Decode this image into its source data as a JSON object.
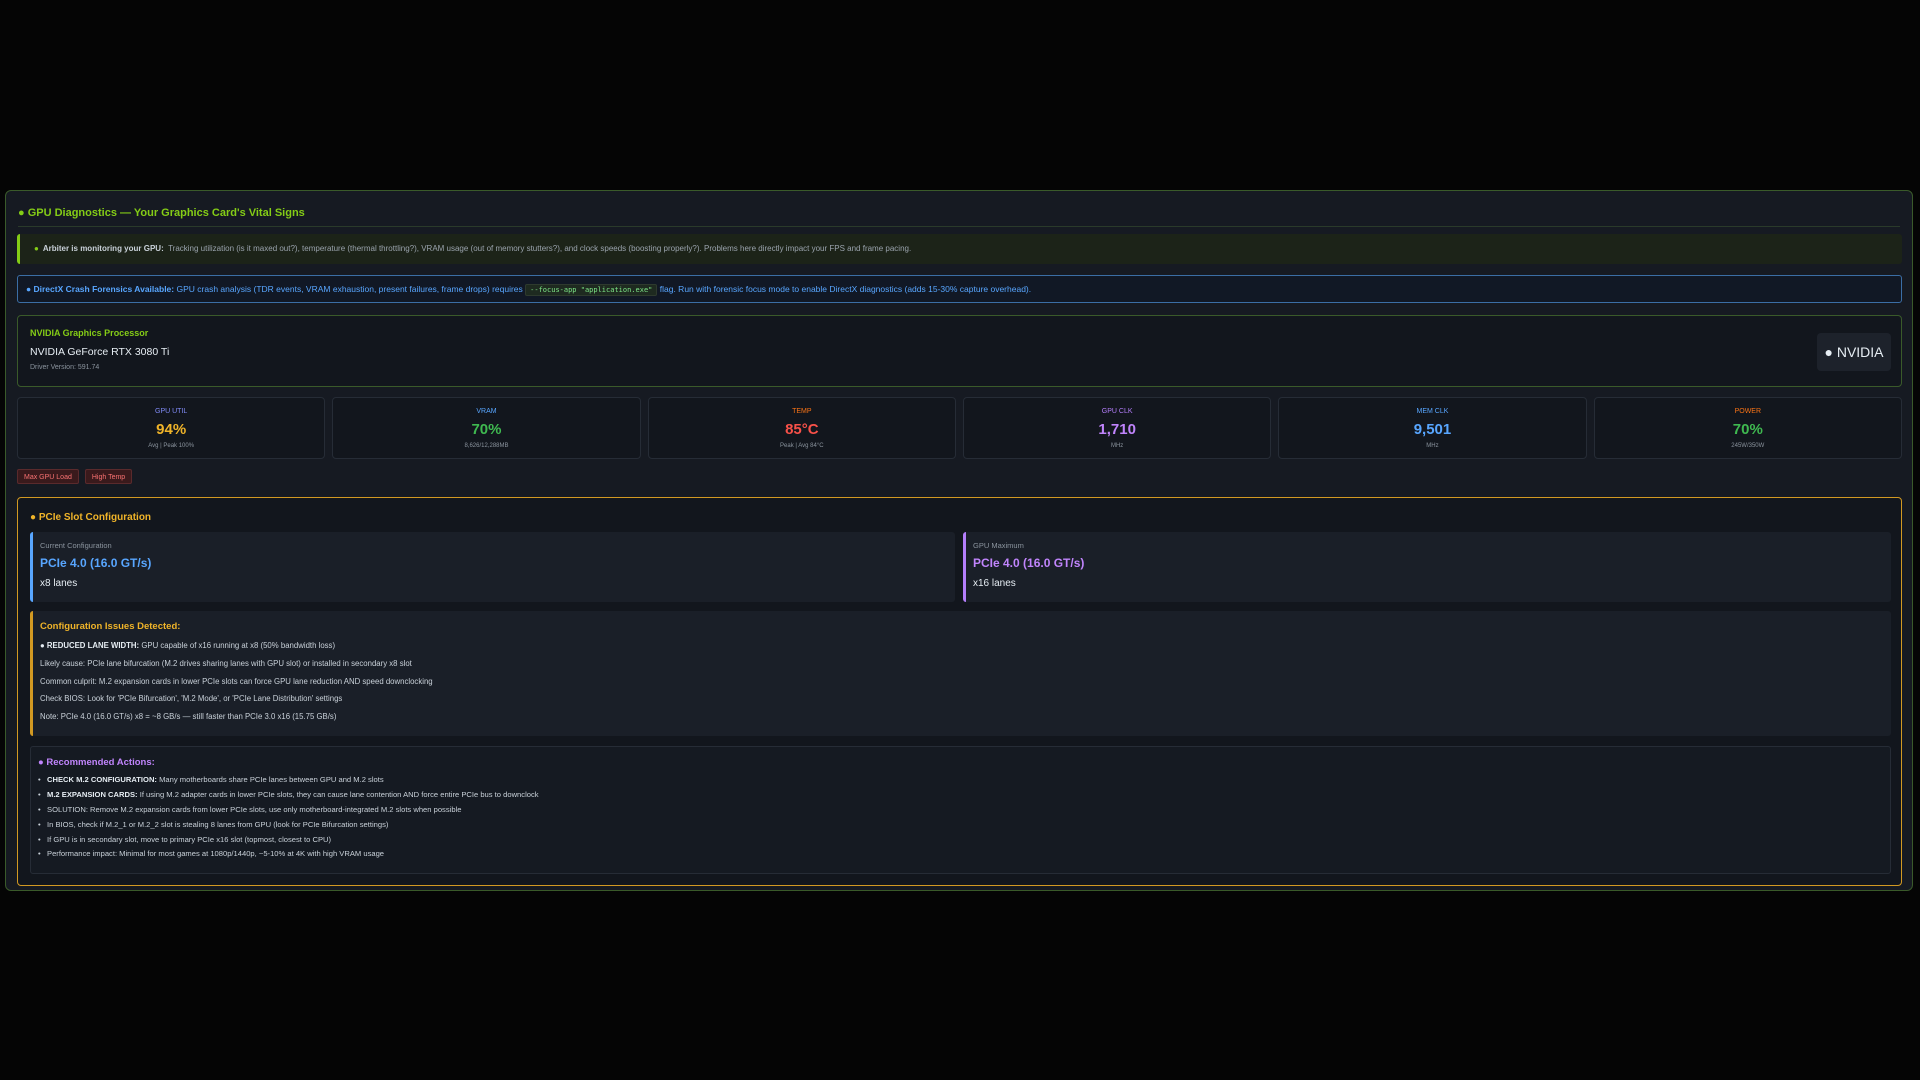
{
  "panel": {
    "title": "● GPU Diagnostics — Your Graphics Card's Vital Signs"
  },
  "monitor": {
    "bullet": "●",
    "lead": "Arbiter is monitoring your GPU:",
    "text": "Tracking utilization (is it maxed out?), temperature (thermal throttling?), VRAM usage (out of memory stutters?), and clock speeds (boosting properly?). Problems here directly impact your FPS and frame pacing."
  },
  "forensics": {
    "lead": "● DirectX Crash Forensics Available:",
    "text_before": "GPU crash analysis (TDR events, VRAM exhaustion, present failures, frame drops) requires",
    "flag": "--focus-app \"application.exe\"",
    "text_after": "flag. Run with forensic focus mode to enable DirectX diagnostics (adds 15-30% capture overhead)."
  },
  "gpu": {
    "label": "NVIDIA Graphics Processor",
    "name": "NVIDIA GeForce RTX 3080 Ti",
    "driver": "Driver Version: 591.74",
    "vendor_badge": "● NVIDIA"
  },
  "metrics": [
    {
      "label": "GPU UTIL",
      "value": "94%",
      "sub": "Avg | Peak 100%",
      "label_color": "#818cf8",
      "value_color": "#f0b429"
    },
    {
      "label": "VRAM",
      "value": "70%",
      "sub": "8,626/12,288MB",
      "label_color": "#58a6ff",
      "value_color": "#3fb950"
    },
    {
      "label": "TEMP",
      "value": "85°C",
      "sub": "Peak | Avg 84°C",
      "label_color": "#f97316",
      "value_color": "#f85149"
    },
    {
      "label": "GPU CLK",
      "value": "1,710",
      "sub": "MHz",
      "label_color": "#b47efb",
      "value_color": "#c084fc"
    },
    {
      "label": "MEM CLK",
      "value": "9,501",
      "sub": "MHz",
      "label_color": "#58a6ff",
      "value_color": "#58a6ff"
    },
    {
      "label": "POWER",
      "value": "70%",
      "sub": "245W/350W",
      "label_color": "#f97316",
      "value_color": "#3fb950"
    }
  ],
  "tags": [
    "Max GPU Load",
    "High Temp"
  ],
  "pcie": {
    "title": "● PCIe Slot Configuration",
    "current": {
      "label": "Current Configuration",
      "value": "PCIe 4.0 (16.0 GT/s)",
      "lanes": "x8 lanes"
    },
    "maximum": {
      "label": "GPU Maximum",
      "value": "PCIe 4.0 (16.0 GT/s)",
      "lanes": "x16 lanes"
    },
    "issues": {
      "title": "Configuration Issues Detected:",
      "first_bold": "● REDUCED LANE WIDTH:",
      "first_text": "GPU capable of x16 running at x8 (50% bandwidth loss)",
      "lines": [
        "Likely cause: PCIe lane bifurcation (M.2 drives sharing lanes with GPU slot) or installed in secondary x8 slot",
        "Common culprit: M.2 expansion cards in lower PCIe slots can force GPU lane reduction AND speed downclocking",
        "Check BIOS: Look for 'PCIe Bifurcation', 'M.2 Mode', or 'PCIe Lane Distribution' settings",
        "Note: PCIe 4.0 (16.0 GT/s) x8 = ~8 GB/s — still faster than PCIe 3.0 x16 (15.75 GB/s)"
      ]
    },
    "actions": {
      "title": "● Recommended Actions:",
      "a1_bold": "CHECK M.2 CONFIGURATION:",
      "a1_text": "Many motherboards share PCIe lanes between GPU and M.2 slots",
      "a2_bold": "M.2 EXPANSION CARDS:",
      "a2_text": "If using M.2 adapter cards in lower PCIe slots, they can cause lane contention AND force entire PCIe bus to downclock",
      "a3": "SOLUTION: Remove M.2 expansion cards from lower PCIe slots, use only motherboard-integrated M.2 slots when possible",
      "a4": "In BIOS, check if M.2_1 or M.2_2 slot is stealing 8 lanes from GPU (look for PCIe Bifurcation settings)",
      "a5": "If GPU is in secondary slot, move to primary PCIe x16 slot (topmost, closest to CPU)",
      "a6": "Performance impact: Minimal for most games at 1080p/1440p, ~5-10% at 4K with high VRAM usage"
    }
  }
}
